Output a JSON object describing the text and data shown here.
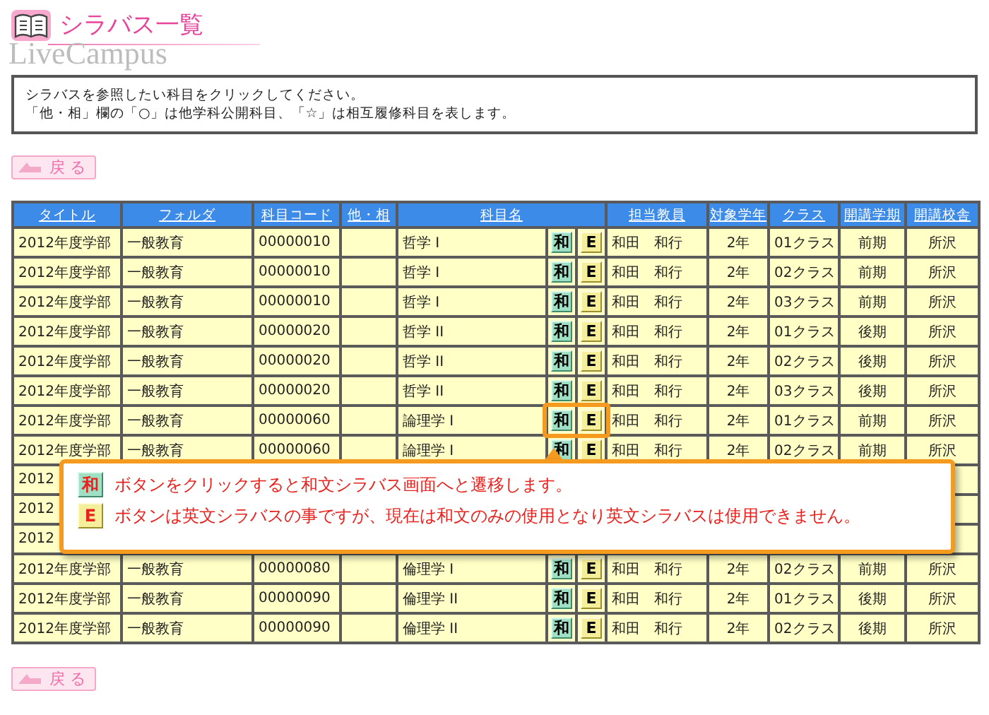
{
  "header": {
    "title": "シラバス一覧",
    "logo_text": "LiveCampus"
  },
  "notice": [
    "シラバスを参照したい科目をクリックしてください。",
    "「他・相」欄の「○」は他学科公開科目、「☆」は相互履修科目を表します。"
  ],
  "back_buttons": [
    {
      "label": "戻 る"
    },
    {
      "label": "戻 る"
    }
  ],
  "table": {
    "columns": [
      "タイトル",
      "フォルダ",
      "科目コード",
      "他・相",
      "科目名",
      "担当教員",
      "対象学年",
      "クラス",
      "開講学期",
      "開講校舎"
    ],
    "rows": [
      {
        "title": "2012年度学部",
        "folder": "一般教育",
        "code": "00000010",
        "course": "哲学 I",
        "wa": "和",
        "e": "E",
        "teacher": "和田　和行",
        "year": "2年",
        "class": "01クラス",
        "term": "前期",
        "campus": "所沢",
        "highlighted": false
      },
      {
        "title": "2012年度学部",
        "folder": "一般教育",
        "code": "00000010",
        "course": "哲学 I",
        "wa": "和",
        "e": "E",
        "teacher": "和田　和行",
        "year": "2年",
        "class": "02クラス",
        "term": "前期",
        "campus": "所沢",
        "highlighted": false
      },
      {
        "title": "2012年度学部",
        "folder": "一般教育",
        "code": "00000010",
        "course": "哲学 I",
        "wa": "和",
        "e": "E",
        "teacher": "和田　和行",
        "year": "2年",
        "class": "03クラス",
        "term": "前期",
        "campus": "所沢",
        "highlighted": false
      },
      {
        "title": "2012年度学部",
        "folder": "一般教育",
        "code": "00000020",
        "course": "哲学 II",
        "wa": "和",
        "e": "E",
        "teacher": "和田　和行",
        "year": "2年",
        "class": "01クラス",
        "term": "後期",
        "campus": "所沢",
        "highlighted": false
      },
      {
        "title": "2012年度学部",
        "folder": "一般教育",
        "code": "00000020",
        "course": "哲学 II",
        "wa": "和",
        "e": "E",
        "teacher": "和田　和行",
        "year": "2年",
        "class": "02クラス",
        "term": "後期",
        "campus": "所沢",
        "highlighted": false
      },
      {
        "title": "2012年度学部",
        "folder": "一般教育",
        "code": "00000020",
        "course": "哲学 II",
        "wa": "和",
        "e": "E",
        "teacher": "和田　和行",
        "year": "2年",
        "class": "03クラス",
        "term": "後期",
        "campus": "所沢",
        "highlighted": false
      },
      {
        "title": "2012年度学部",
        "folder": "一般教育",
        "code": "00000060",
        "course": "論理学 I",
        "wa": "和",
        "e": "E",
        "teacher": "和田　和行",
        "year": "2年",
        "class": "01クラス",
        "term": "前期",
        "campus": "所沢",
        "highlighted": true
      },
      {
        "title": "2012年度学部",
        "folder": "一般教育",
        "code": "00000060",
        "course": "論理学 I",
        "wa": "和",
        "e": "E",
        "teacher": "和田　和行",
        "year": "2年",
        "class": "02クラス",
        "term": "前期",
        "campus": "所沢",
        "highlighted": false
      },
      {
        "title": "2012",
        "highlighted": false
      },
      {
        "title": "2012",
        "highlighted": false
      },
      {
        "title": "2012",
        "highlighted": false
      },
      {
        "title": "2012年度学部",
        "folder": "一般教育",
        "code": "00000080",
        "course": "倫理学 I",
        "wa": "和",
        "e": "E",
        "teacher": "和田　和行",
        "year": "2年",
        "class": "02クラス",
        "term": "前期",
        "campus": "所沢",
        "highlighted": false
      },
      {
        "title": "2012年度学部",
        "folder": "一般教育",
        "code": "00000090",
        "course": "倫理学 II",
        "wa": "和",
        "e": "E",
        "teacher": "和田　和行",
        "year": "2年",
        "class": "01クラス",
        "term": "後期",
        "campus": "所沢",
        "highlighted": false
      },
      {
        "title": "2012年度学部",
        "folder": "一般教育",
        "code": "00000090",
        "course": "倫理学 II",
        "wa": "和",
        "e": "E",
        "teacher": "和田　和行",
        "year": "2年",
        "class": "02クラス",
        "term": "後期",
        "campus": "所沢",
        "highlighted": false
      }
    ]
  },
  "callout": {
    "lines": [
      {
        "kind": "wa",
        "button": "和",
        "text": "ボタンをクリックすると和文シラバス画面へと遷移します。"
      },
      {
        "kind": "e",
        "button": "E",
        "text": "ボタンは英文シラバスの事ですが、現在は和文のみの使用となり英文シラバスは使用できません。"
      }
    ]
  }
}
